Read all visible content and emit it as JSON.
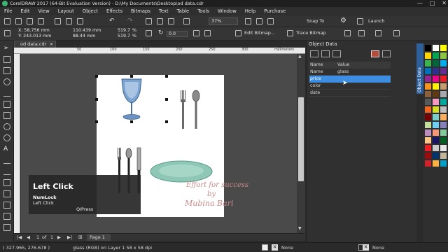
{
  "window": {
    "title": "CorelDRAW 2017 (64-Bit Evaluation Version) - D:\\My Documents\\Desktop\\od data.cdr"
  },
  "menu": {
    "items": [
      "File",
      "Edit",
      "View",
      "Layout",
      "Object",
      "Effects",
      "Bitmaps",
      "Text",
      "Table",
      "Tools",
      "Window",
      "Help",
      "Purchase"
    ]
  },
  "toolbar": {
    "zoom": "37%",
    "snap_to": "Snap To",
    "launch": "Launch"
  },
  "property_bar": {
    "x": "X: 58.756 mm",
    "y": "Y: 243.013 mm",
    "width": "110.439 mm",
    "height": "88.44 mm",
    "scale_x": "519.7",
    "scale_y": "519.7",
    "pct": "%",
    "rotation": "0.0",
    "edit_bitmap": "Edit Bitmap...",
    "trace_bitmap": "Trace Bitmap"
  },
  "document": {
    "tab_label": "od data.cdr",
    "ruler_unit": "millimeters",
    "ruler_ticks": [
      "0",
      "50",
      "100",
      "150",
      "200",
      "250",
      "300",
      "350"
    ],
    "page_nav": {
      "current": "1",
      "of": "of",
      "total": "1",
      "page_label": "Page 1"
    }
  },
  "canvas": {
    "watermark_line1": "Effort for success",
    "watermark_line2": "by",
    "watermark_line3": "Mubina Bari"
  },
  "keystroke_overlay": {
    "title": "Left Click",
    "line1": "NumLock",
    "line2": "Left Click",
    "brand": "QIPress"
  },
  "docker": {
    "title": "Object Data",
    "side_tab": "Object Data",
    "columns": [
      "Name",
      "Value"
    ],
    "rows": [
      {
        "name": "Name",
        "value": "glass"
      },
      {
        "name": "price",
        "value": ""
      },
      {
        "name": "color",
        "value": ""
      },
      {
        "name": "date",
        "value": ""
      }
    ],
    "selected_row": 1,
    "selection_color": "#3d8de0"
  },
  "status_bar": {
    "coords": "( 327.965, 276.678 )",
    "object_info": "glass (RGB) on Layer 1 58 x 58 dpi",
    "fill_label": "None",
    "outline_label": "None"
  },
  "palette": {
    "colors": [
      "#000000",
      "#ffffff",
      "#ffff00",
      "#ffd700",
      "#00a651",
      "#8dc63f",
      "#39b54a",
      "#006838",
      "#00aeef",
      "#0072bc",
      "#2e3192",
      "#662d91",
      "#92278f",
      "#ec008c",
      "#ed1c24",
      "#f7941d",
      "#fff200",
      "#c69c6d",
      "#8b5e3c",
      "#603913",
      "#a7a9ac",
      "#58595b",
      "#f49ac1",
      "#00a99d",
      "#f26522",
      "#d7df23",
      "#bcbec0",
      "#790000",
      "#7accc8",
      "#fbaf5d",
      "#c4df9b",
      "#6dcff6",
      "#8781bd",
      "#bd8cbf",
      "#f7977a",
      "#82ca9c",
      "#fdc689",
      "#1b1464",
      "#005e20",
      "#ee1d23",
      "#cccccc",
      "#e6e6e6",
      "#9e0b0f",
      "#003471",
      "#c2b59b",
      "#d2232a",
      "#fbb040",
      "#00a0c6"
    ]
  }
}
